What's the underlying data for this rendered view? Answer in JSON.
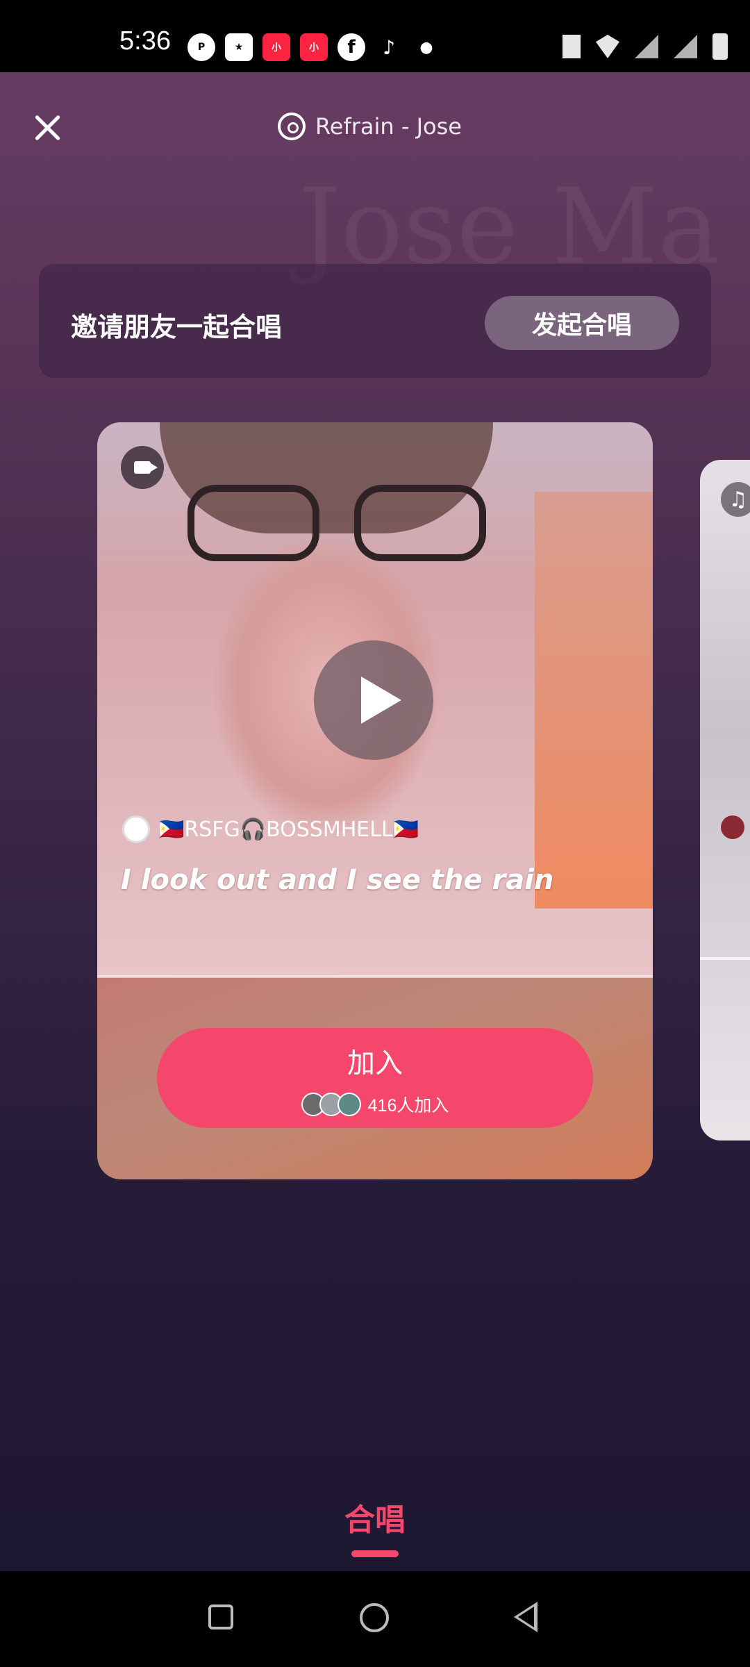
{
  "status_bar": {
    "time": "5:36",
    "notification_icons": [
      "p-icon",
      "star-icon",
      "xiaohongshu-icon",
      "xiaohongshu-icon",
      "facebook-icon",
      "tiktok-icon",
      "dot-icon"
    ],
    "system_icons": [
      "vibrate-icon",
      "wifi-icon",
      "no-signal-icon",
      "no-signal-icon",
      "battery-charging-icon"
    ]
  },
  "header": {
    "close_icon": "close-icon",
    "song_title": "Refrain - Jose"
  },
  "background_text": "Jose Ma",
  "invite": {
    "text": "邀请朋友一起合唱",
    "button_label": "发起合唱"
  },
  "card": {
    "media_type_icon": "video-camera-icon",
    "username": "🇵🇭RSFG🎧BOSSMHELL🇵🇭",
    "lyric": "I look out and I see the rain",
    "join_button": {
      "label": "加入",
      "participants_text": "416人加入"
    }
  },
  "next_card": {
    "media_type_icon": "music-note-icon"
  },
  "bottom_tab": {
    "label": "合唱",
    "active_color": "#f4476b"
  },
  "nav_bar": [
    "recents-icon",
    "home-icon",
    "back-icon"
  ]
}
